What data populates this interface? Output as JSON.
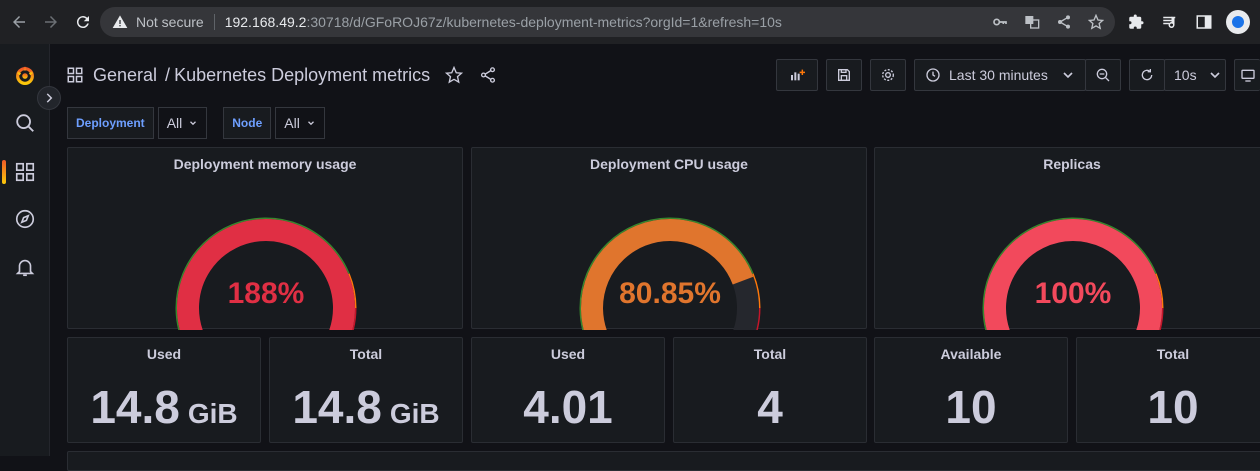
{
  "browser": {
    "not_secure_label": "Not secure",
    "url_host": "192.168.49.2",
    "url_path": ":30718/d/GFoROJ67z/kubernetes-deployment-metrics?orgId=1&refresh=10s"
  },
  "sidemenu": {
    "items": [
      "grafana-logo-icon",
      "search-icon",
      "dashboards-icon",
      "explore-icon",
      "alerting-icon"
    ]
  },
  "header": {
    "breadcrumb_folder": "General",
    "breadcrumb_separator": "/",
    "title": "Kubernetes Deployment metrics"
  },
  "toolbar": {
    "time_range": "Last 30 minutes",
    "refresh_interval": "10s"
  },
  "variables": [
    {
      "label": "Deployment",
      "value": "All"
    },
    {
      "label": "Node",
      "value": "All"
    }
  ],
  "gauges": [
    {
      "title": "Deployment memory usage",
      "value_text": "188%",
      "fill": 1.0,
      "color": "#e02f44",
      "value_color": "#e02f44"
    },
    {
      "title": "Deployment CPU usage",
      "value_text": "80.85%",
      "fill": 0.8085,
      "color": "#e0752d",
      "value_color": "#e0752d"
    },
    {
      "title": "Replicas",
      "value_text": "100%",
      "fill": 1.0,
      "color": "#f2495c",
      "value_color": "#f2495c"
    }
  ],
  "stats": [
    {
      "title": "Used",
      "value": "14.8",
      "unit": "GiB"
    },
    {
      "title": "Total",
      "value": "14.8",
      "unit": "GiB"
    },
    {
      "title": "Used",
      "value": "4.01",
      "unit": ""
    },
    {
      "title": "Total",
      "value": "4",
      "unit": ""
    },
    {
      "title": "Available",
      "value": "10",
      "unit": ""
    },
    {
      "title": "Total",
      "value": "10",
      "unit": ""
    }
  ],
  "colors": {
    "threshold_green": "#37872d",
    "threshold_orange": "#ff780a",
    "threshold_red": "#c4162a",
    "track": "#25272d"
  }
}
